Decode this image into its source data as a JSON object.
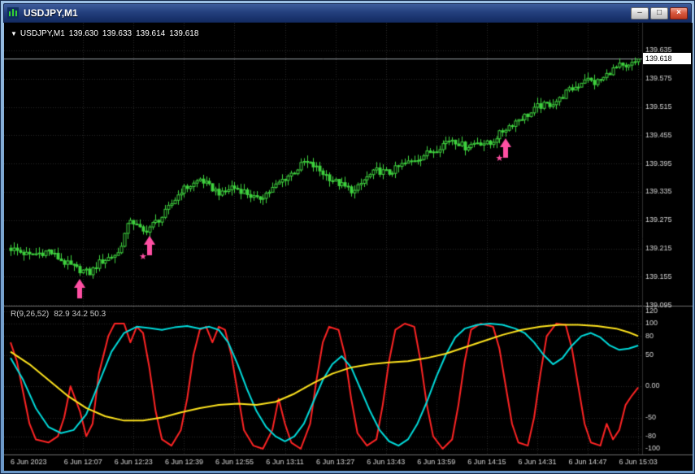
{
  "window": {
    "title": "USDJPY,M1",
    "controls": {
      "minimize": "–",
      "maximize": "□",
      "close": "×"
    }
  },
  "main_chart": {
    "header": {
      "marker": "▼",
      "symbol": "USDJPY,M1",
      "open": "139.630",
      "high": "139.633",
      "low": "139.614",
      "close": "139.618"
    },
    "current_price_label": "139.618"
  },
  "indicator": {
    "name": "R(9,26,52)",
    "values": "82.9 34.2 50.3"
  },
  "colors": {
    "candle": "#3fd23f",
    "arrow": "#ff4fa3",
    "grid": "#282828",
    "axis_text": "#d4d4d4",
    "bid_line": "#9aa0a6",
    "separator": "#6e6e6e"
  },
  "chart_data": [
    {
      "type": "candlestick",
      "symbol": "USDJPY",
      "timeframe": "M1",
      "title": "USDJPY,M1",
      "current_price": 139.618,
      "y_ticks": [
        "139.635",
        "139.575",
        "139.515",
        "139.455",
        "139.395",
        "139.335",
        "139.275",
        "139.215",
        "139.155",
        "139.095"
      ],
      "x_date_label": "6 Jun 2023",
      "x_ticks": [
        {
          "m": 23,
          "label": "6 Jun 12:07"
        },
        {
          "m": 39,
          "label": "6 Jun 12:23"
        },
        {
          "m": 55,
          "label": "6 Jun 12:39"
        },
        {
          "m": 71,
          "label": "6 Jun 12:55"
        },
        {
          "m": 87,
          "label": "6 Jun 13:11"
        },
        {
          "m": 103,
          "label": "6 Jun 13:27"
        },
        {
          "m": 119,
          "label": "6 Jun 13:43"
        },
        {
          "m": 135,
          "label": "6 Jun 13:59"
        },
        {
          "m": 151,
          "label": "6 Jun 14:15"
        },
        {
          "m": 167,
          "label": "6 Jun 14:31"
        },
        {
          "m": 183,
          "label": "6 Jun 14:47"
        },
        {
          "m": 199,
          "label": "6 Jun 15:03"
        }
      ],
      "price_keyframes": [
        [
          0,
          139.215
        ],
        [
          6,
          139.2
        ],
        [
          12,
          139.21
        ],
        [
          17,
          139.185
        ],
        [
          21,
          139.172
        ],
        [
          25,
          139.163
        ],
        [
          28,
          139.185
        ],
        [
          34,
          139.205
        ],
        [
          36,
          139.245
        ],
        [
          38,
          139.278
        ],
        [
          40,
          139.262
        ],
        [
          42,
          139.25
        ],
        [
          45,
          139.266
        ],
        [
          48,
          139.282
        ],
        [
          51,
          139.31
        ],
        [
          54,
          139.338
        ],
        [
          58,
          139.352
        ],
        [
          60,
          139.362
        ],
        [
          63,
          139.346
        ],
        [
          67,
          139.33
        ],
        [
          70,
          139.346
        ],
        [
          74,
          139.336
        ],
        [
          78,
          139.318
        ],
        [
          82,
          139.336
        ],
        [
          86,
          139.36
        ],
        [
          90,
          139.378
        ],
        [
          93,
          139.398
        ],
        [
          96,
          139.39
        ],
        [
          98,
          139.38
        ],
        [
          102,
          139.36
        ],
        [
          106,
          139.345
        ],
        [
          109,
          139.336
        ],
        [
          112,
          139.36
        ],
        [
          116,
          139.38
        ],
        [
          120,
          139.375
        ],
        [
          124,
          139.392
        ],
        [
          128,
          139.402
        ],
        [
          131,
          139.413
        ],
        [
          135,
          139.426
        ],
        [
          138,
          139.442
        ],
        [
          140,
          139.447
        ],
        [
          144,
          139.43
        ],
        [
          148,
          139.441
        ],
        [
          152,
          139.436
        ],
        [
          154,
          139.452
        ],
        [
          157,
          139.47
        ],
        [
          161,
          139.49
        ],
        [
          165,
          139.502
        ],
        [
          167,
          139.516
        ],
        [
          171,
          139.521
        ],
        [
          174,
          139.531
        ],
        [
          176,
          139.546
        ],
        [
          180,
          139.561
        ],
        [
          182,
          139.576
        ],
        [
          185,
          139.566
        ],
        [
          188,
          139.576
        ],
        [
          190,
          139.59
        ],
        [
          193,
          139.602
        ],
        [
          195,
          139.596
        ],
        [
          198,
          139.61
        ],
        [
          199,
          139.618
        ]
      ],
      "star_glyph": "★",
      "signals": [
        {
          "shape": "arrow-up",
          "minute": 22,
          "price": 139.15,
          "star": null
        },
        {
          "shape": "arrow-up",
          "minute": 44,
          "price": 139.242,
          "star": {
            "m": 42,
            "price": 139.196
          }
        },
        {
          "shape": "arrow-up",
          "minute": 157,
          "price": 139.448,
          "star": {
            "m": 155,
            "price": 139.405
          }
        }
      ]
    },
    {
      "type": "line",
      "title": "R(9,26,52)",
      "current_values": [
        82.9,
        34.2,
        50.3
      ],
      "ylim": [
        -115,
        125
      ],
      "y_ticks": [
        [
          "120",
          120
        ],
        [
          "100",
          100
        ],
        [
          "80",
          80
        ],
        [
          "50",
          50
        ],
        [
          "0.00",
          0
        ],
        [
          "-50",
          -50
        ],
        [
          "-80",
          -80
        ],
        [
          "-100",
          -100
        ]
      ],
      "series": [
        {
          "name": "fast",
          "color": "#ff2424",
          "points": [
            [
              0,
              70
            ],
            [
              2,
              40
            ],
            [
              4,
              -10
            ],
            [
              6,
              -60
            ],
            [
              8,
              -85
            ],
            [
              12,
              -90
            ],
            [
              15,
              -80
            ],
            [
              17,
              -50
            ],
            [
              19,
              0
            ],
            [
              22,
              -40
            ],
            [
              24,
              -80
            ],
            [
              26,
              -60
            ],
            [
              28,
              20
            ],
            [
              31,
              80
            ],
            [
              33,
              100
            ],
            [
              36,
              100
            ],
            [
              38,
              70
            ],
            [
              40,
              95
            ],
            [
              42,
              85
            ],
            [
              44,
              30
            ],
            [
              46,
              -40
            ],
            [
              48,
              -85
            ],
            [
              51,
              -95
            ],
            [
              54,
              -70
            ],
            [
              56,
              -20
            ],
            [
              58,
              50
            ],
            [
              60,
              90
            ],
            [
              62,
              95
            ],
            [
              64,
              70
            ],
            [
              66,
              95
            ],
            [
              68,
              90
            ],
            [
              70,
              50
            ],
            [
              72,
              -10
            ],
            [
              74,
              -70
            ],
            [
              77,
              -95
            ],
            [
              80,
              -100
            ],
            [
              83,
              -70
            ],
            [
              85,
              -20
            ],
            [
              87,
              -60
            ],
            [
              89,
              -90
            ],
            [
              92,
              -100
            ],
            [
              95,
              -60
            ],
            [
              97,
              10
            ],
            [
              99,
              70
            ],
            [
              101,
              95
            ],
            [
              104,
              90
            ],
            [
              106,
              50
            ],
            [
              108,
              -20
            ],
            [
              110,
              -75
            ],
            [
              113,
              -95
            ],
            [
              116,
              -85
            ],
            [
              118,
              -30
            ],
            [
              120,
              40
            ],
            [
              122,
              90
            ],
            [
              125,
              100
            ],
            [
              128,
              95
            ],
            [
              130,
              40
            ],
            [
              132,
              -30
            ],
            [
              134,
              -80
            ],
            [
              137,
              -100
            ],
            [
              140,
              -85
            ],
            [
              142,
              -30
            ],
            [
              144,
              40
            ],
            [
              146,
              90
            ],
            [
              149,
              100
            ],
            [
              153,
              95
            ],
            [
              155,
              60
            ],
            [
              157,
              0
            ],
            [
              159,
              -60
            ],
            [
              161,
              -90
            ],
            [
              164,
              -95
            ],
            [
              166,
              -50
            ],
            [
              168,
              20
            ],
            [
              170,
              80
            ],
            [
              173,
              100
            ],
            [
              176,
              98
            ],
            [
              178,
              60
            ],
            [
              180,
              0
            ],
            [
              182,
              -60
            ],
            [
              184,
              -90
            ],
            [
              187,
              -95
            ],
            [
              189,
              -60
            ],
            [
              191,
              -85
            ],
            [
              193,
              -70
            ],
            [
              195,
              -30
            ],
            [
              197,
              -15
            ],
            [
              199,
              -2
            ]
          ]
        },
        {
          "name": "medium",
          "color": "#00dcdc",
          "points": [
            [
              0,
              45
            ],
            [
              4,
              10
            ],
            [
              8,
              -35
            ],
            [
              12,
              -65
            ],
            [
              16,
              -75
            ],
            [
              20,
              -70
            ],
            [
              24,
              -45
            ],
            [
              28,
              5
            ],
            [
              32,
              55
            ],
            [
              36,
              85
            ],
            [
              40,
              95
            ],
            [
              44,
              93
            ],
            [
              48,
              90
            ],
            [
              52,
              94
            ],
            [
              56,
              96
            ],
            [
              60,
              92
            ],
            [
              63,
              95
            ],
            [
              66,
              90
            ],
            [
              69,
              70
            ],
            [
              72,
              35
            ],
            [
              75,
              -5
            ],
            [
              78,
              -40
            ],
            [
              81,
              -65
            ],
            [
              84,
              -80
            ],
            [
              87,
              -88
            ],
            [
              90,
              -80
            ],
            [
              93,
              -60
            ],
            [
              96,
              -25
            ],
            [
              99,
              10
            ],
            [
              102,
              35
            ],
            [
              105,
              48
            ],
            [
              108,
              30
            ],
            [
              111,
              -5
            ],
            [
              114,
              -40
            ],
            [
              117,
              -70
            ],
            [
              120,
              -88
            ],
            [
              123,
              -95
            ],
            [
              126,
              -85
            ],
            [
              129,
              -60
            ],
            [
              132,
              -25
            ],
            [
              135,
              15
            ],
            [
              138,
              50
            ],
            [
              141,
              78
            ],
            [
              144,
              92
            ],
            [
              148,
              98
            ],
            [
              152,
              100
            ],
            [
              156,
              98
            ],
            [
              160,
              92
            ],
            [
              163,
              85
            ],
            [
              166,
              70
            ],
            [
              169,
              50
            ],
            [
              172,
              35
            ],
            [
              175,
              45
            ],
            [
              178,
              65
            ],
            [
              181,
              80
            ],
            [
              184,
              85
            ],
            [
              187,
              78
            ],
            [
              190,
              65
            ],
            [
              193,
              58
            ],
            [
              196,
              60
            ],
            [
              199,
              65
            ]
          ]
        },
        {
          "name": "slow",
          "color": "#ffe41e",
          "points": [
            [
              0,
              55
            ],
            [
              6,
              35
            ],
            [
              12,
              10
            ],
            [
              18,
              -15
            ],
            [
              24,
              -35
            ],
            [
              30,
              -48
            ],
            [
              36,
              -55
            ],
            [
              42,
              -55
            ],
            [
              48,
              -50
            ],
            [
              54,
              -42
            ],
            [
              60,
              -35
            ],
            [
              66,
              -30
            ],
            [
              72,
              -28
            ],
            [
              78,
              -30
            ],
            [
              84,
              -25
            ],
            [
              90,
              -12
            ],
            [
              96,
              5
            ],
            [
              102,
              20
            ],
            [
              108,
              30
            ],
            [
              114,
              35
            ],
            [
              120,
              38
            ],
            [
              126,
              40
            ],
            [
              132,
              45
            ],
            [
              138,
              52
            ],
            [
              144,
              62
            ],
            [
              150,
              72
            ],
            [
              156,
              82
            ],
            [
              162,
              90
            ],
            [
              168,
              95
            ],
            [
              174,
              98
            ],
            [
              180,
              98
            ],
            [
              186,
              96
            ],
            [
              192,
              92
            ],
            [
              196,
              86
            ],
            [
              199,
              80
            ]
          ]
        }
      ]
    }
  ]
}
